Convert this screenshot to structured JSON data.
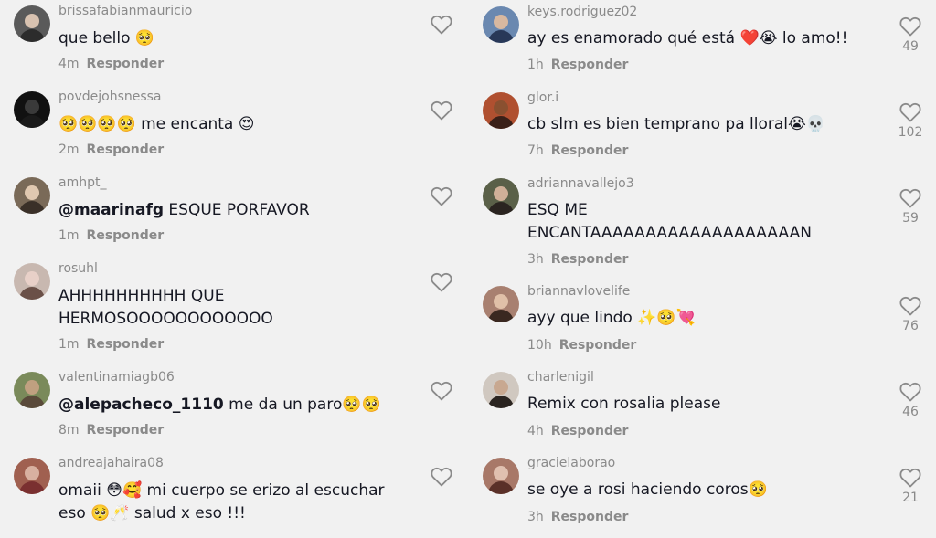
{
  "left": [
    {
      "username": "brissafabianmauricio",
      "text": "que bello 🥺",
      "time": "4m",
      "reply": "Responder",
      "av": [
        "#5a5a5a",
        "#d8c2b0",
        "#2c2c2c"
      ]
    },
    {
      "username": "povdejohsnessa",
      "text": "🥺🥺🥺🥺 me encanta 😍",
      "time": "2m",
      "reply": "Responder",
      "av": [
        "#111111",
        "#3a3a3a",
        "#1a1a1a"
      ]
    },
    {
      "username": "amhpt_",
      "mention": "@maarinafg",
      "text": " ESQUE PORFAVOR",
      "time": "1m",
      "reply": "Responder",
      "av": [
        "#7a6a58",
        "#e0c8b0",
        "#3a3028"
      ]
    },
    {
      "username": "rosuhl",
      "text": "AHHHHHHHHHH QUE\nHERMOSOOOOOOOOOOOO",
      "time": "1m",
      "reply": "Responder",
      "av": [
        "#c8b8b0",
        "#e8d0c8",
        "#6a5048"
      ]
    },
    {
      "username": "valentinamiagb06",
      "mention": "@alepacheco_1110",
      "text": " me da un paro🥺🥺",
      "time": "8m",
      "reply": "Responder",
      "av": [
        "#7a8a5a",
        "#c0a080",
        "#5a4a3a"
      ]
    },
    {
      "username": "andreajahaira08",
      "text": "omaii 😳🥰 mi cuerpo se erizo al escuchar\neso 🥺🥂 salud x eso !!!",
      "time": "",
      "reply": "",
      "av": [
        "#a06050",
        "#d8b0a0",
        "#7a3030"
      ]
    }
  ],
  "right": [
    {
      "username": "keys.rodriguez02",
      "text": "ay es enamorado qué está ❤️😭 lo amo!!",
      "time": "1h",
      "reply": "Responder",
      "likes": "49",
      "av": [
        "#6a88b0",
        "#d8b8a0",
        "#283858"
      ]
    },
    {
      "username": "glor.i",
      "text": "cb slm es bien temprano pa lloral😭💀",
      "time": "7h",
      "reply": "Responder",
      "likes": "102",
      "av": [
        "#b05030",
        "#8a5030",
        "#3a2018"
      ]
    },
    {
      "username": "adriannavallejo3",
      "text": "ESQ ME\nENCANTAAAAAAAAAAAAAAAAAAAN",
      "time": "3h",
      "reply": "Responder",
      "likes": "59",
      "av": [
        "#5a6048",
        "#d0b098",
        "#2a2420"
      ]
    },
    {
      "username": "briannavlovelife",
      "text": "ayy que lindo ✨🥺💘",
      "time": "10h",
      "reply": "Responder",
      "likes": "76",
      "av": [
        "#a88070",
        "#e0c0a8",
        "#3a2820"
      ]
    },
    {
      "username": "charlenigil",
      "text": "Remix con rosalia please",
      "time": "4h",
      "reply": "Responder",
      "likes": "46",
      "av": [
        "#d0c8c0",
        "#c8a890",
        "#2a2420"
      ]
    },
    {
      "username": "gracielaborao",
      "text": "se oye a rosi haciendo coros🥺",
      "time": "3h",
      "reply": "Responder",
      "likes": "21",
      "av": [
        "#a87868",
        "#e0c0b0",
        "#5a3028"
      ]
    }
  ]
}
